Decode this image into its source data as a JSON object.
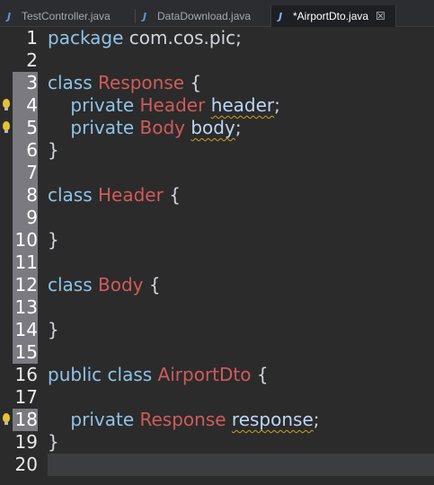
{
  "tabs": [
    {
      "label": "TestController.java",
      "icon": "java-file-icon",
      "active": false
    },
    {
      "label": "DataDownload.java",
      "icon": "java-file-icon",
      "active": false
    },
    {
      "label": "*AirportDto.java",
      "icon": "java-file-icon",
      "active": true,
      "close": "☒"
    }
  ],
  "icon_glyph": "J",
  "current_line": 20,
  "lines": [
    {
      "n": "1",
      "tokens": [
        [
          "kw",
          "package "
        ],
        [
          "txt",
          "com.cos.pic;"
        ]
      ]
    },
    {
      "n": "2",
      "tokens": []
    },
    {
      "n": "3",
      "tokens": [
        [
          "kw",
          "class "
        ],
        [
          "cls",
          "Response"
        ],
        [
          "txt",
          " {"
        ]
      ]
    },
    {
      "n": "4",
      "tokens": [
        [
          "kw",
          "    private "
        ],
        [
          "cls",
          "Header "
        ],
        [
          "field",
          "header"
        ],
        [
          "txt",
          ";"
        ]
      ],
      "warn": true
    },
    {
      "n": "5",
      "tokens": [
        [
          "kw",
          "    private "
        ],
        [
          "cls",
          "Body "
        ],
        [
          "field",
          "body"
        ],
        [
          "txt",
          ";"
        ]
      ],
      "warn": true
    },
    {
      "n": "6",
      "tokens": [
        [
          "txt",
          "}"
        ]
      ]
    },
    {
      "n": "7",
      "tokens": []
    },
    {
      "n": "8",
      "tokens": [
        [
          "kw",
          "class "
        ],
        [
          "cls",
          "Header"
        ],
        [
          "txt",
          " {"
        ]
      ]
    },
    {
      "n": "9",
      "tokens": []
    },
    {
      "n": "10",
      "tokens": [
        [
          "txt",
          "}"
        ]
      ]
    },
    {
      "n": "11",
      "tokens": []
    },
    {
      "n": "12",
      "tokens": [
        [
          "kw",
          "class "
        ],
        [
          "cls",
          "Body"
        ],
        [
          "txt",
          " {"
        ]
      ]
    },
    {
      "n": "13",
      "tokens": []
    },
    {
      "n": "14",
      "tokens": [
        [
          "txt",
          "}"
        ]
      ]
    },
    {
      "n": "15",
      "tokens": []
    },
    {
      "n": "16",
      "tokens": [
        [
          "kw",
          "public class "
        ],
        [
          "cls",
          "AirportDto"
        ],
        [
          "txt",
          " {"
        ]
      ]
    },
    {
      "n": "17",
      "tokens": []
    },
    {
      "n": "18",
      "tokens": [
        [
          "kw",
          "    private "
        ],
        [
          "cls",
          "Response "
        ],
        [
          "field",
          "response"
        ],
        [
          "txt",
          ";"
        ]
      ],
      "warn": true
    },
    {
      "n": "19",
      "tokens": [
        [
          "txt",
          "}"
        ]
      ]
    },
    {
      "n": "20",
      "tokens": []
    }
  ]
}
